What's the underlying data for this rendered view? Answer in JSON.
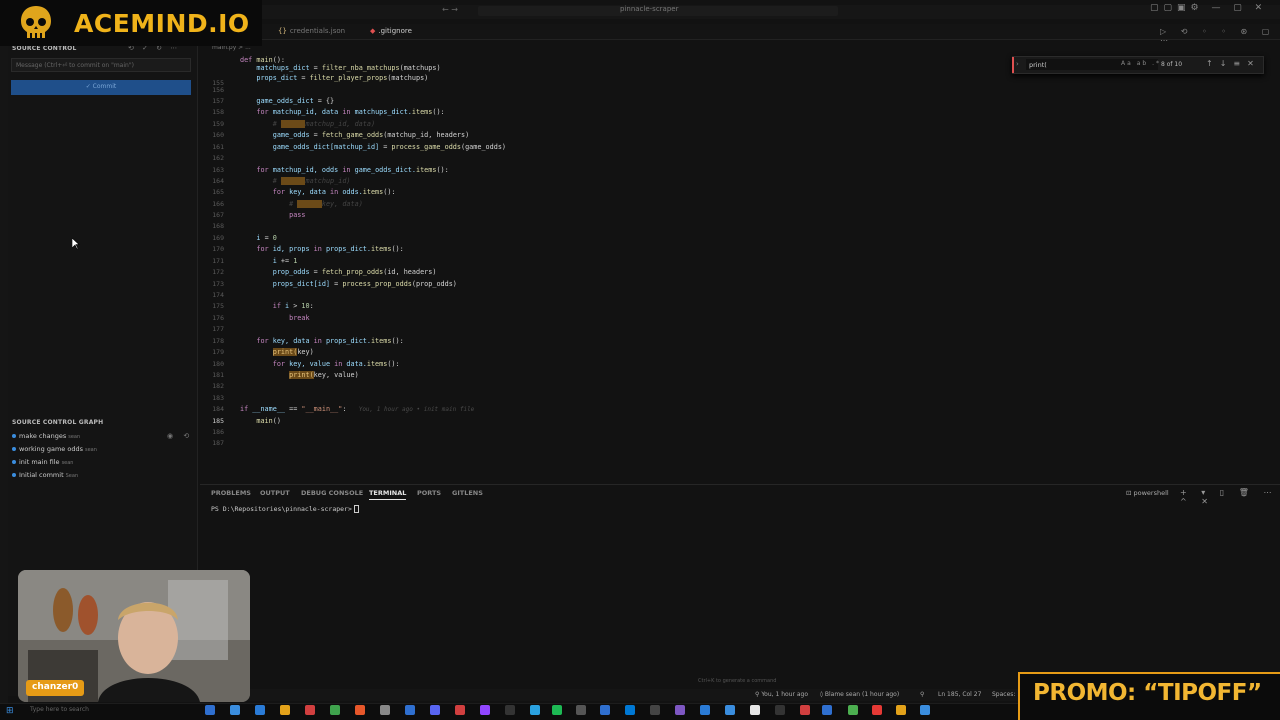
{
  "logo": {
    "text": "ACEMIND.IO"
  },
  "titlebar": {
    "title": "pinnacle-scraper",
    "nav": "←  →"
  },
  "sidebar": {
    "source_control_title": "SOURCE CONTROL",
    "commit_placeholder": "Message (Ctrl+⏎ to commit on \"main\")",
    "commit_label": "✓ Commit",
    "graph_title": "SOURCE CONTROL GRAPH",
    "graph_items": [
      {
        "label": "make changes",
        "author": "sean"
      },
      {
        "label": "working game odds",
        "author": "sean"
      },
      {
        "label": "init main file",
        "author": "sean"
      },
      {
        "label": "Initial commit",
        "author": "Sean"
      }
    ]
  },
  "tabs": [
    {
      "label": "credentials.json",
      "icon": "{}"
    },
    {
      "label": ".gitignore",
      "icon": "◆"
    }
  ],
  "breadcrumb": "main.py > ...",
  "editor": {
    "line_numbers": [
      "155",
      "156",
      "157",
      "158",
      "159",
      "160",
      "161",
      "162",
      "163",
      "164",
      "165",
      "166",
      "167",
      "168",
      "169",
      "170",
      "171",
      "172",
      "173",
      "174",
      "175",
      "176",
      "177",
      "178",
      "179",
      "180",
      "181",
      "182",
      "183",
      "184",
      "185",
      "186",
      "187"
    ],
    "first_line": "def main():",
    "blame_185": "You, 1 hour ago • init main file"
  },
  "find": {
    "query": "print(",
    "options": "Aa ab .*",
    "count": "8 of 10"
  },
  "panel": {
    "tabs": [
      "PROBLEMS",
      "OUTPUT",
      "DEBUG CONSOLE",
      "TERMINAL",
      "PORTS",
      "GITLENS"
    ],
    "active_tab": "TERMINAL",
    "prompt": "PS D:\\Repositories\\pinnacle-scraper>",
    "shell": "powershell",
    "hint": "Ctrl+K to generate a command"
  },
  "statusbar": {
    "blame": "You, 1 hour ago",
    "blame2": "Blame sean (1 hour ago)",
    "position": "Ln 185, Col 27",
    "spaces": "Spaces:"
  },
  "taskbar": {
    "search": "Type here to search"
  },
  "webcam": {
    "name": "chanzer0"
  },
  "promo": {
    "text": "PROMO: “TIPOFF”"
  },
  "colors": {
    "accent": "#f0b31a",
    "promo": "#e69b16",
    "commit": "#1f4f8a"
  }
}
